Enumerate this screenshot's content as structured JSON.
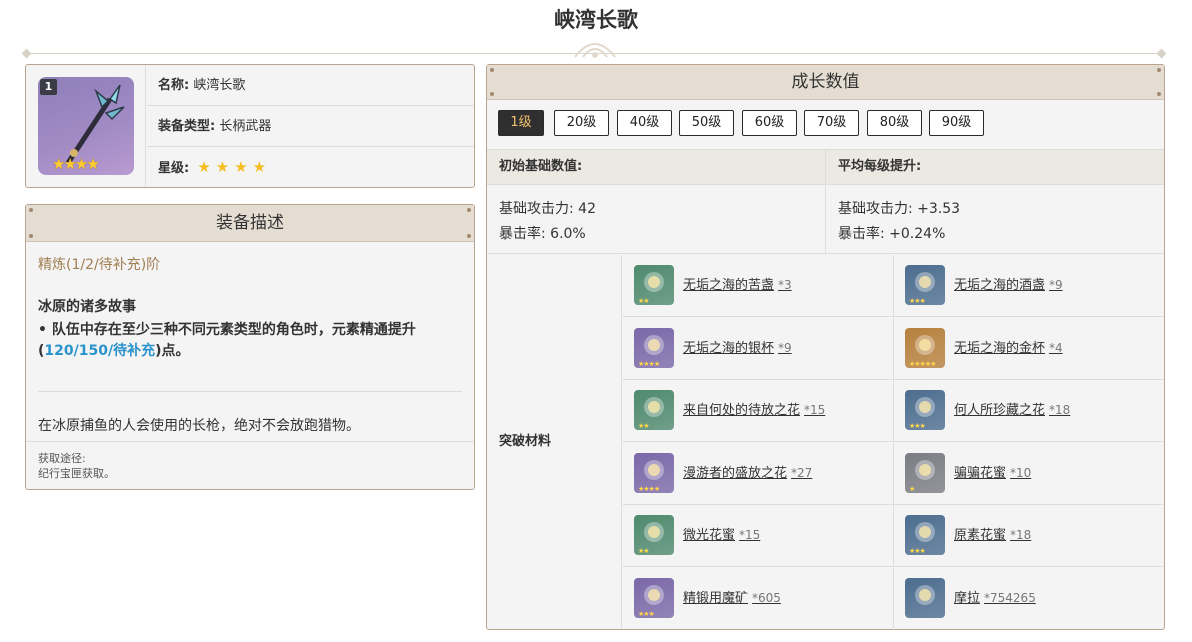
{
  "page": {
    "title": "峡湾长歌"
  },
  "weapon": {
    "level_badge": "1",
    "icon_stars": "★★★★",
    "name_key": "名称:",
    "name_value": "峡湾长歌",
    "type_key": "装备类型:",
    "type_value": "长柄武器",
    "rarity_key": "星级:",
    "rarity_stars": "★★★★",
    "icon_name": "polearm-icon"
  },
  "description": {
    "header": "装备描述",
    "refine": "精炼(1/2/待补充)阶",
    "passive_title": "冰原的诸多故事",
    "passive_text_a": "• 队伍中存在至少三种不同元素类型的角色时，元素精通提升(",
    "passive_text_hl": "120/150/待补充",
    "passive_text_b": ")点。",
    "flavor": "在冰原捕鱼的人会使用的长枪，绝对不会放跑猎物。",
    "source_label": "获取途径:",
    "source_value": "纪行宝匣获取。"
  },
  "growth": {
    "header": "成长数值",
    "tabs": [
      "1级",
      "20级",
      "40级",
      "50级",
      "60级",
      "70级",
      "80级",
      "90级"
    ],
    "active_tab": "1级",
    "base_header": "初始基础数值:",
    "growth_header": "平均每级提升:",
    "base_atk": "基础攻击力: 42",
    "base_crit": "暴击率: 6.0%",
    "growth_atk": "基础攻击力: +3.53",
    "growth_crit": "暴击率: +0.24%",
    "materials_label": "突破材料",
    "materials": [
      {
        "name": "无垢之海的苦盏",
        "count": "*3",
        "stars": "★★",
        "color": "#4f8a6e"
      },
      {
        "name": "无垢之海的酒盏",
        "count": "*9",
        "stars": "★★★",
        "color": "#4c6d8f"
      },
      {
        "name": "无垢之海的银杯",
        "count": "*9",
        "stars": "★★★★",
        "color": "#7a68a8"
      },
      {
        "name": "无垢之海的金杯",
        "count": "*4",
        "stars": "★★★★★",
        "color": "#b7813e"
      },
      {
        "name": "来自何处的待放之花",
        "count": "*15",
        "stars": "★★",
        "color": "#4f8a6e"
      },
      {
        "name": "何人所珍藏之花",
        "count": "*18",
        "stars": "★★★",
        "color": "#4c6d8f"
      },
      {
        "name": "漫游者的盛放之花",
        "count": "*27",
        "stars": "★★★★",
        "color": "#7a68a8"
      },
      {
        "name": "骗骗花蜜",
        "count": "*10",
        "stars": "★",
        "color": "#7b7d84"
      },
      {
        "name": "微光花蜜",
        "count": "*15",
        "stars": "★★",
        "color": "#4f8a6e"
      },
      {
        "name": "原素花蜜",
        "count": "*18",
        "stars": "★★★",
        "color": "#4c6d8f"
      },
      {
        "name": "精锻用魔矿",
        "count": "*605",
        "stars": "★★★",
        "color": "#7a68a8"
      },
      {
        "name": "摩拉",
        "count": "*754265",
        "stars": "",
        "color": "#4c6d8f"
      }
    ]
  }
}
